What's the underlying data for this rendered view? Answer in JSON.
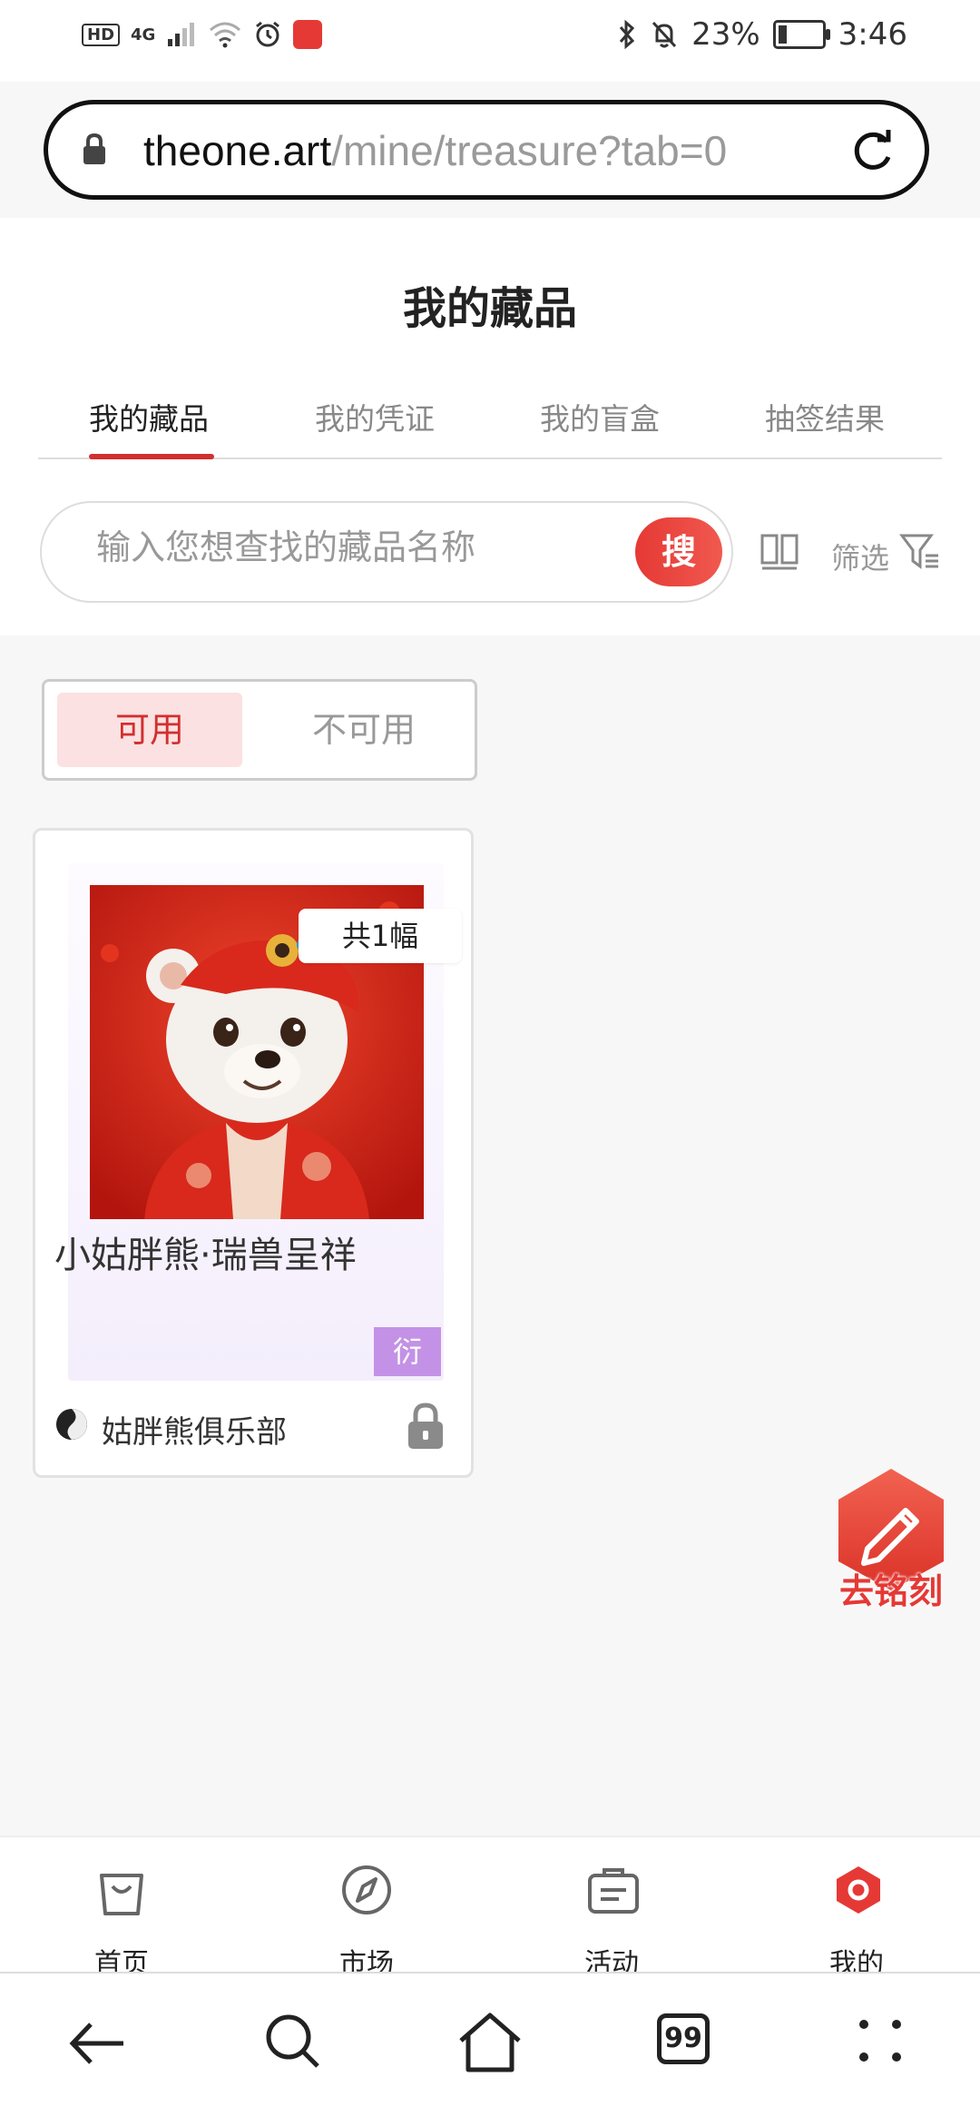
{
  "status_bar": {
    "hd_badge": "HD",
    "network": "4G",
    "battery_text": "23%",
    "time": "3:46",
    "battery_level": 0.23
  },
  "browser": {
    "url_host": "theone.art",
    "url_path": "/mine/treasure?tab=0"
  },
  "page": {
    "title": "我的藏品"
  },
  "tabs": [
    {
      "label": "我的藏品",
      "active": true
    },
    {
      "label": "我的凭证",
      "active": false
    },
    {
      "label": "我的盲盒",
      "active": false
    },
    {
      "label": "抽签结果",
      "active": false
    }
  ],
  "search": {
    "placeholder": "输入您想查找的藏品名称",
    "button_label": "搜",
    "filter_label": "筛选"
  },
  "availability": {
    "available_label": "可用",
    "unavailable_label": "不可用"
  },
  "item": {
    "count_tag": "共1幅",
    "title": "小姑胖熊·瑞兽呈祥",
    "derive_tag": "衍",
    "club_name": "姑胖熊俱乐部"
  },
  "floating": {
    "engrave_label": "去铭刻"
  },
  "bottom_nav": [
    {
      "label": "首页",
      "icon": "bag-icon"
    },
    {
      "label": "市场",
      "icon": "compass-icon"
    },
    {
      "label": "活动",
      "icon": "briefcase-icon"
    },
    {
      "label": "我的",
      "icon": "profile-icon"
    }
  ],
  "system_nav": {
    "tabs_count": "99"
  },
  "colors": {
    "accent": "#d32f2f",
    "derive_tag": "#c392e6"
  }
}
